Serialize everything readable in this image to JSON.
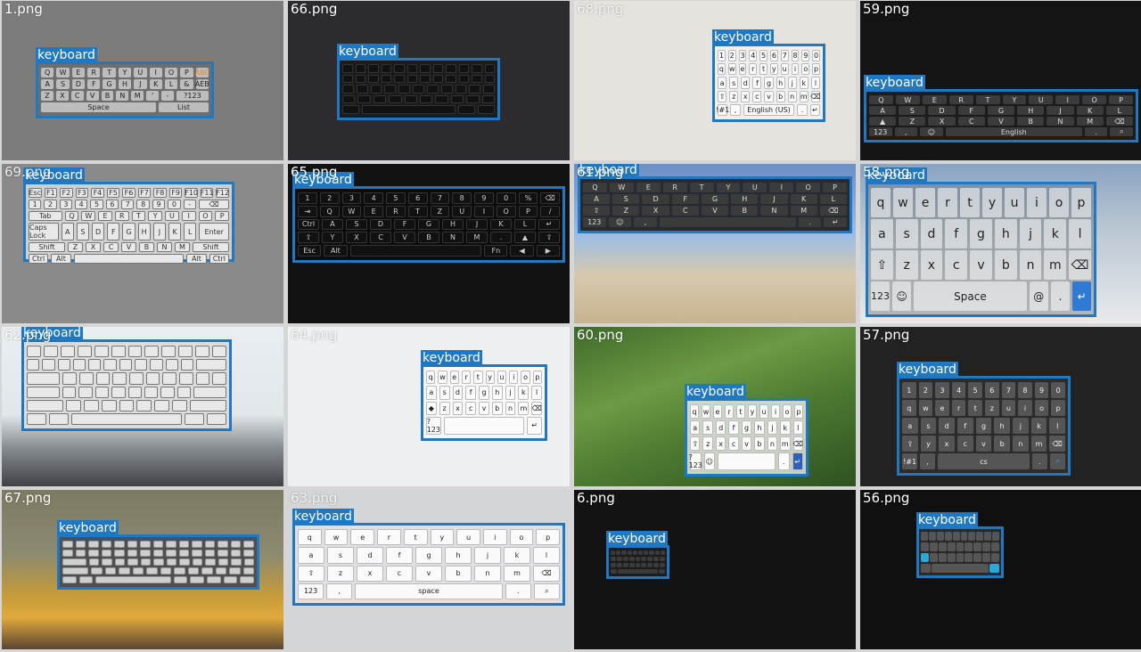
{
  "box_label": "keyboard",
  "colors": {
    "box": "#1f78c1",
    "label_text": "#ffffff"
  },
  "tiles": [
    {
      "file": "1.png"
    },
    {
      "file": "66.png"
    },
    {
      "file": "68.png"
    },
    {
      "file": "59.png"
    },
    {
      "file": "69.png"
    },
    {
      "file": "65.png"
    },
    {
      "file": "61.png"
    },
    {
      "file": "58.png"
    },
    {
      "file": "62.png"
    },
    {
      "file": "64.png"
    },
    {
      "file": "60.png"
    },
    {
      "file": "57.png"
    },
    {
      "file": "67.png"
    },
    {
      "file": "63.png"
    },
    {
      "file": "6.png"
    },
    {
      "file": "56.png"
    }
  ]
}
